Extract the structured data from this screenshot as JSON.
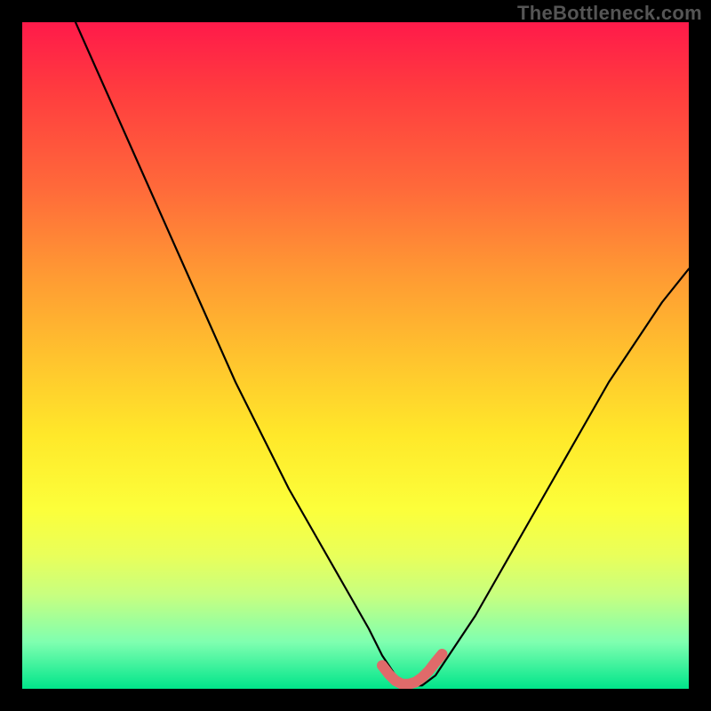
{
  "attribution": "TheBottleneck.com",
  "chart_data": {
    "type": "line",
    "title": "",
    "xlabel": "",
    "ylabel": "",
    "xlim": [
      0,
      100
    ],
    "ylim": [
      0,
      100
    ],
    "series": [
      {
        "name": "bottleneck-curve",
        "x": [
          8,
          12,
          16,
          20,
          24,
          28,
          32,
          36,
          40,
          44,
          48,
          52,
          54,
          56,
          58,
          60,
          62,
          64,
          68,
          72,
          76,
          80,
          84,
          88,
          92,
          96,
          100
        ],
        "y": [
          100,
          91,
          82,
          73,
          64,
          55,
          46,
          38,
          30,
          23,
          16,
          9,
          5,
          2,
          0.5,
          0.5,
          2,
          5,
          11,
          18,
          25,
          32,
          39,
          46,
          52,
          58,
          63
        ]
      },
      {
        "name": "optimal-band",
        "x": [
          54,
          55,
          56,
          57,
          58,
          59,
          60,
          61,
          62,
          63
        ],
        "y": [
          3.5,
          2.2,
          1.2,
          0.7,
          0.7,
          1.0,
          1.7,
          2.7,
          4.0,
          5.2
        ]
      }
    ],
    "colors": {
      "curve": "#000000",
      "optimal_band": "#e06a6a",
      "gradient_top": "#ff1a4a",
      "gradient_bottom": "#00e58a"
    }
  }
}
